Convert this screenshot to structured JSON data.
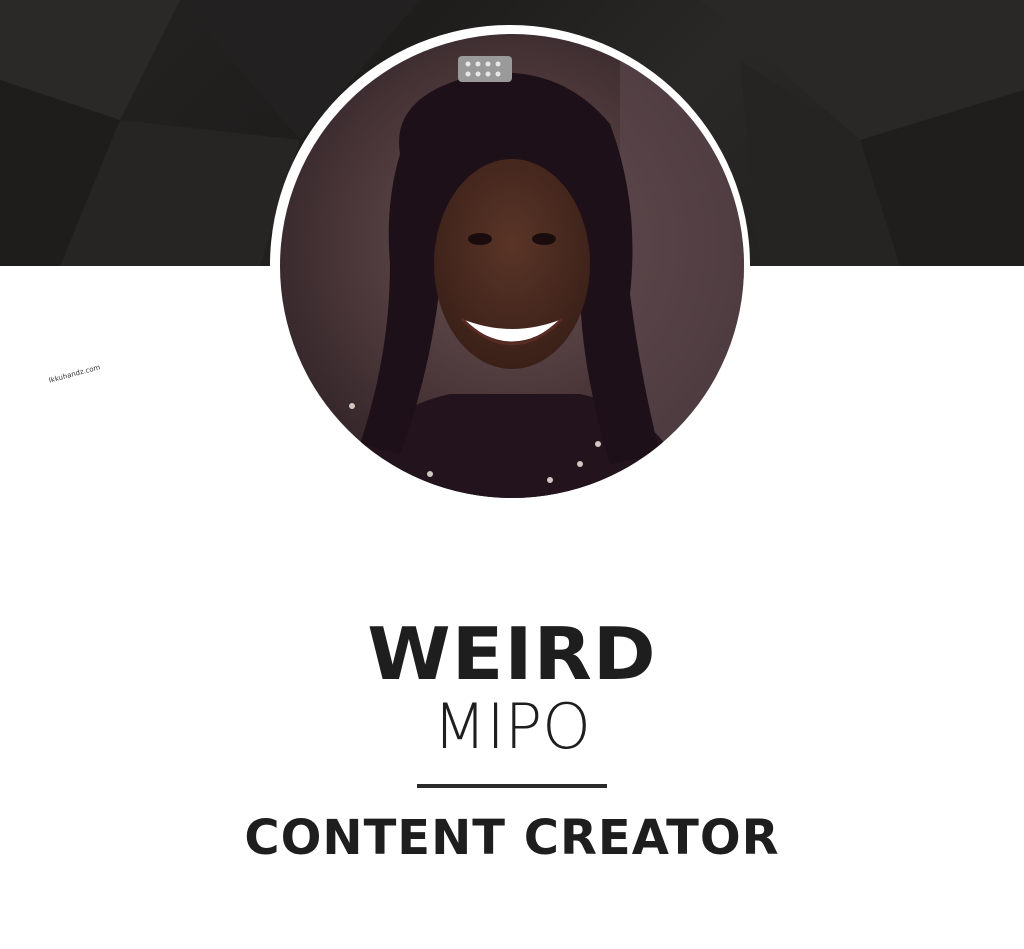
{
  "profile": {
    "first_name": "WEIRD",
    "last_name": "MIPO",
    "role": "CONTENT CREATOR"
  },
  "colors": {
    "banner": "#232120",
    "text": "#1e1e1e",
    "background": "#ffffff"
  }
}
